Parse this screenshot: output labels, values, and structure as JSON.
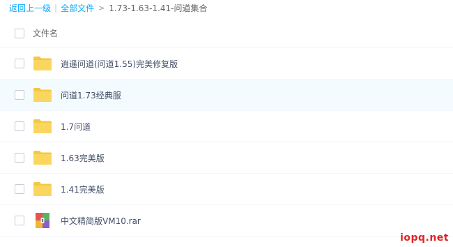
{
  "breadcrumb": {
    "back": "返回上一级",
    "separator": "|",
    "root": "全部文件",
    "arrow": ">",
    "current": "1.73-1.63-1.41-问道集合"
  },
  "list": {
    "column_header": "文件名",
    "files": [
      {
        "name": "逍遥问道(问道1.55)完美修复版",
        "type": "folder",
        "icon": "folder-icon"
      },
      {
        "name": "问道1.73经典服",
        "type": "folder",
        "icon": "folder-icon"
      },
      {
        "name": "1.7问道",
        "type": "folder",
        "icon": "folder-icon"
      },
      {
        "name": "1.63完美版",
        "type": "folder",
        "icon": "folder-icon"
      },
      {
        "name": "1.41完美版",
        "type": "folder",
        "icon": "folder-icon"
      },
      {
        "name": "中文精简版VM10.rar",
        "type": "archive",
        "icon": "rar-archive-icon"
      }
    ]
  },
  "watermark": "iopq.net",
  "colors": {
    "link": "#09aaff",
    "folder": "#f9d35c",
    "hover_row": "#f4fbff",
    "watermark": "#e02424"
  }
}
